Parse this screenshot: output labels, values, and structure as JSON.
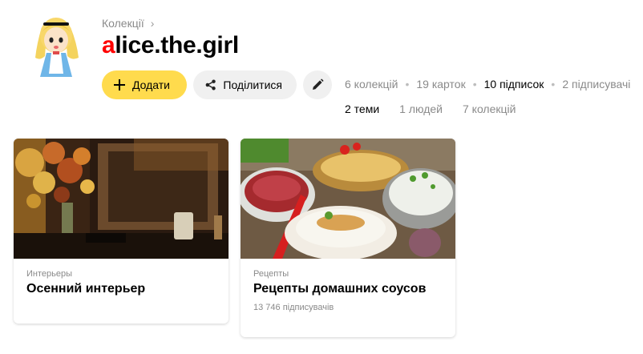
{
  "breadcrumb": {
    "label": "Колекції",
    "chevron": "›"
  },
  "profile": {
    "name_first": "a",
    "name_rest": "lice.the.girl",
    "avatar_icon": "alice-avatar"
  },
  "actions": {
    "add_label": "Додати",
    "share_label": "Поділитися",
    "edit_icon": "pencil-icon"
  },
  "stats": {
    "items": [
      {
        "label": "6 колекцій",
        "active": false
      },
      {
        "label": "19 карток",
        "active": false
      },
      {
        "label": "10 підписок",
        "active": true
      },
      {
        "label": "2 підписувачі",
        "active": false
      }
    ],
    "separator": "•"
  },
  "subtabs": [
    {
      "label": "2 теми",
      "active": true
    },
    {
      "label": "1 людей",
      "active": false
    },
    {
      "label": "7 колекцій",
      "active": false
    }
  ],
  "cards": [
    {
      "category": "Интерьеры",
      "title": "Осенний интерьер",
      "subscribers": ""
    },
    {
      "category": "Рецепты",
      "title": "Рецепты домашних соусов",
      "subscribers": "13 746 підписувачів"
    }
  ],
  "colors": {
    "accent_yellow": "#ffdb4d",
    "brand_red": "#ff0000",
    "muted": "#8a8a8a"
  }
}
